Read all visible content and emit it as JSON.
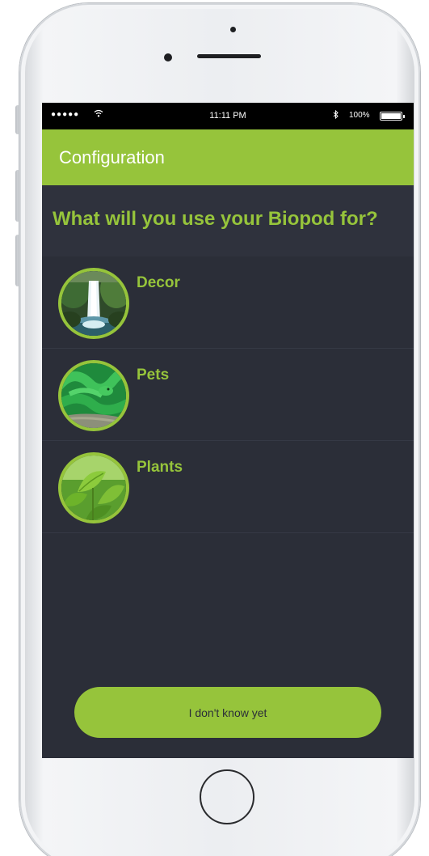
{
  "status_bar": {
    "signal": "●●●●●",
    "wifi_icon": "wifi-icon",
    "time": "11:11 PM",
    "bluetooth_icon": "bluetooth-icon",
    "battery_percent": "100%",
    "battery_level": 1.0
  },
  "app_bar": {
    "title": "Configuration"
  },
  "question": {
    "text": "What will you use your Biopod for?"
  },
  "options": [
    {
      "label": "Decor",
      "image": "waterfall-image"
    },
    {
      "label": "Pets",
      "image": "snake-image"
    },
    {
      "label": "Plants",
      "image": "leaves-image"
    }
  ],
  "footer": {
    "dont_know_label": "I don't know yet"
  },
  "colors": {
    "accent": "#96c43b",
    "background": "#2b2e38",
    "question_bg": "#2f323d",
    "status_bar": "#000000"
  }
}
